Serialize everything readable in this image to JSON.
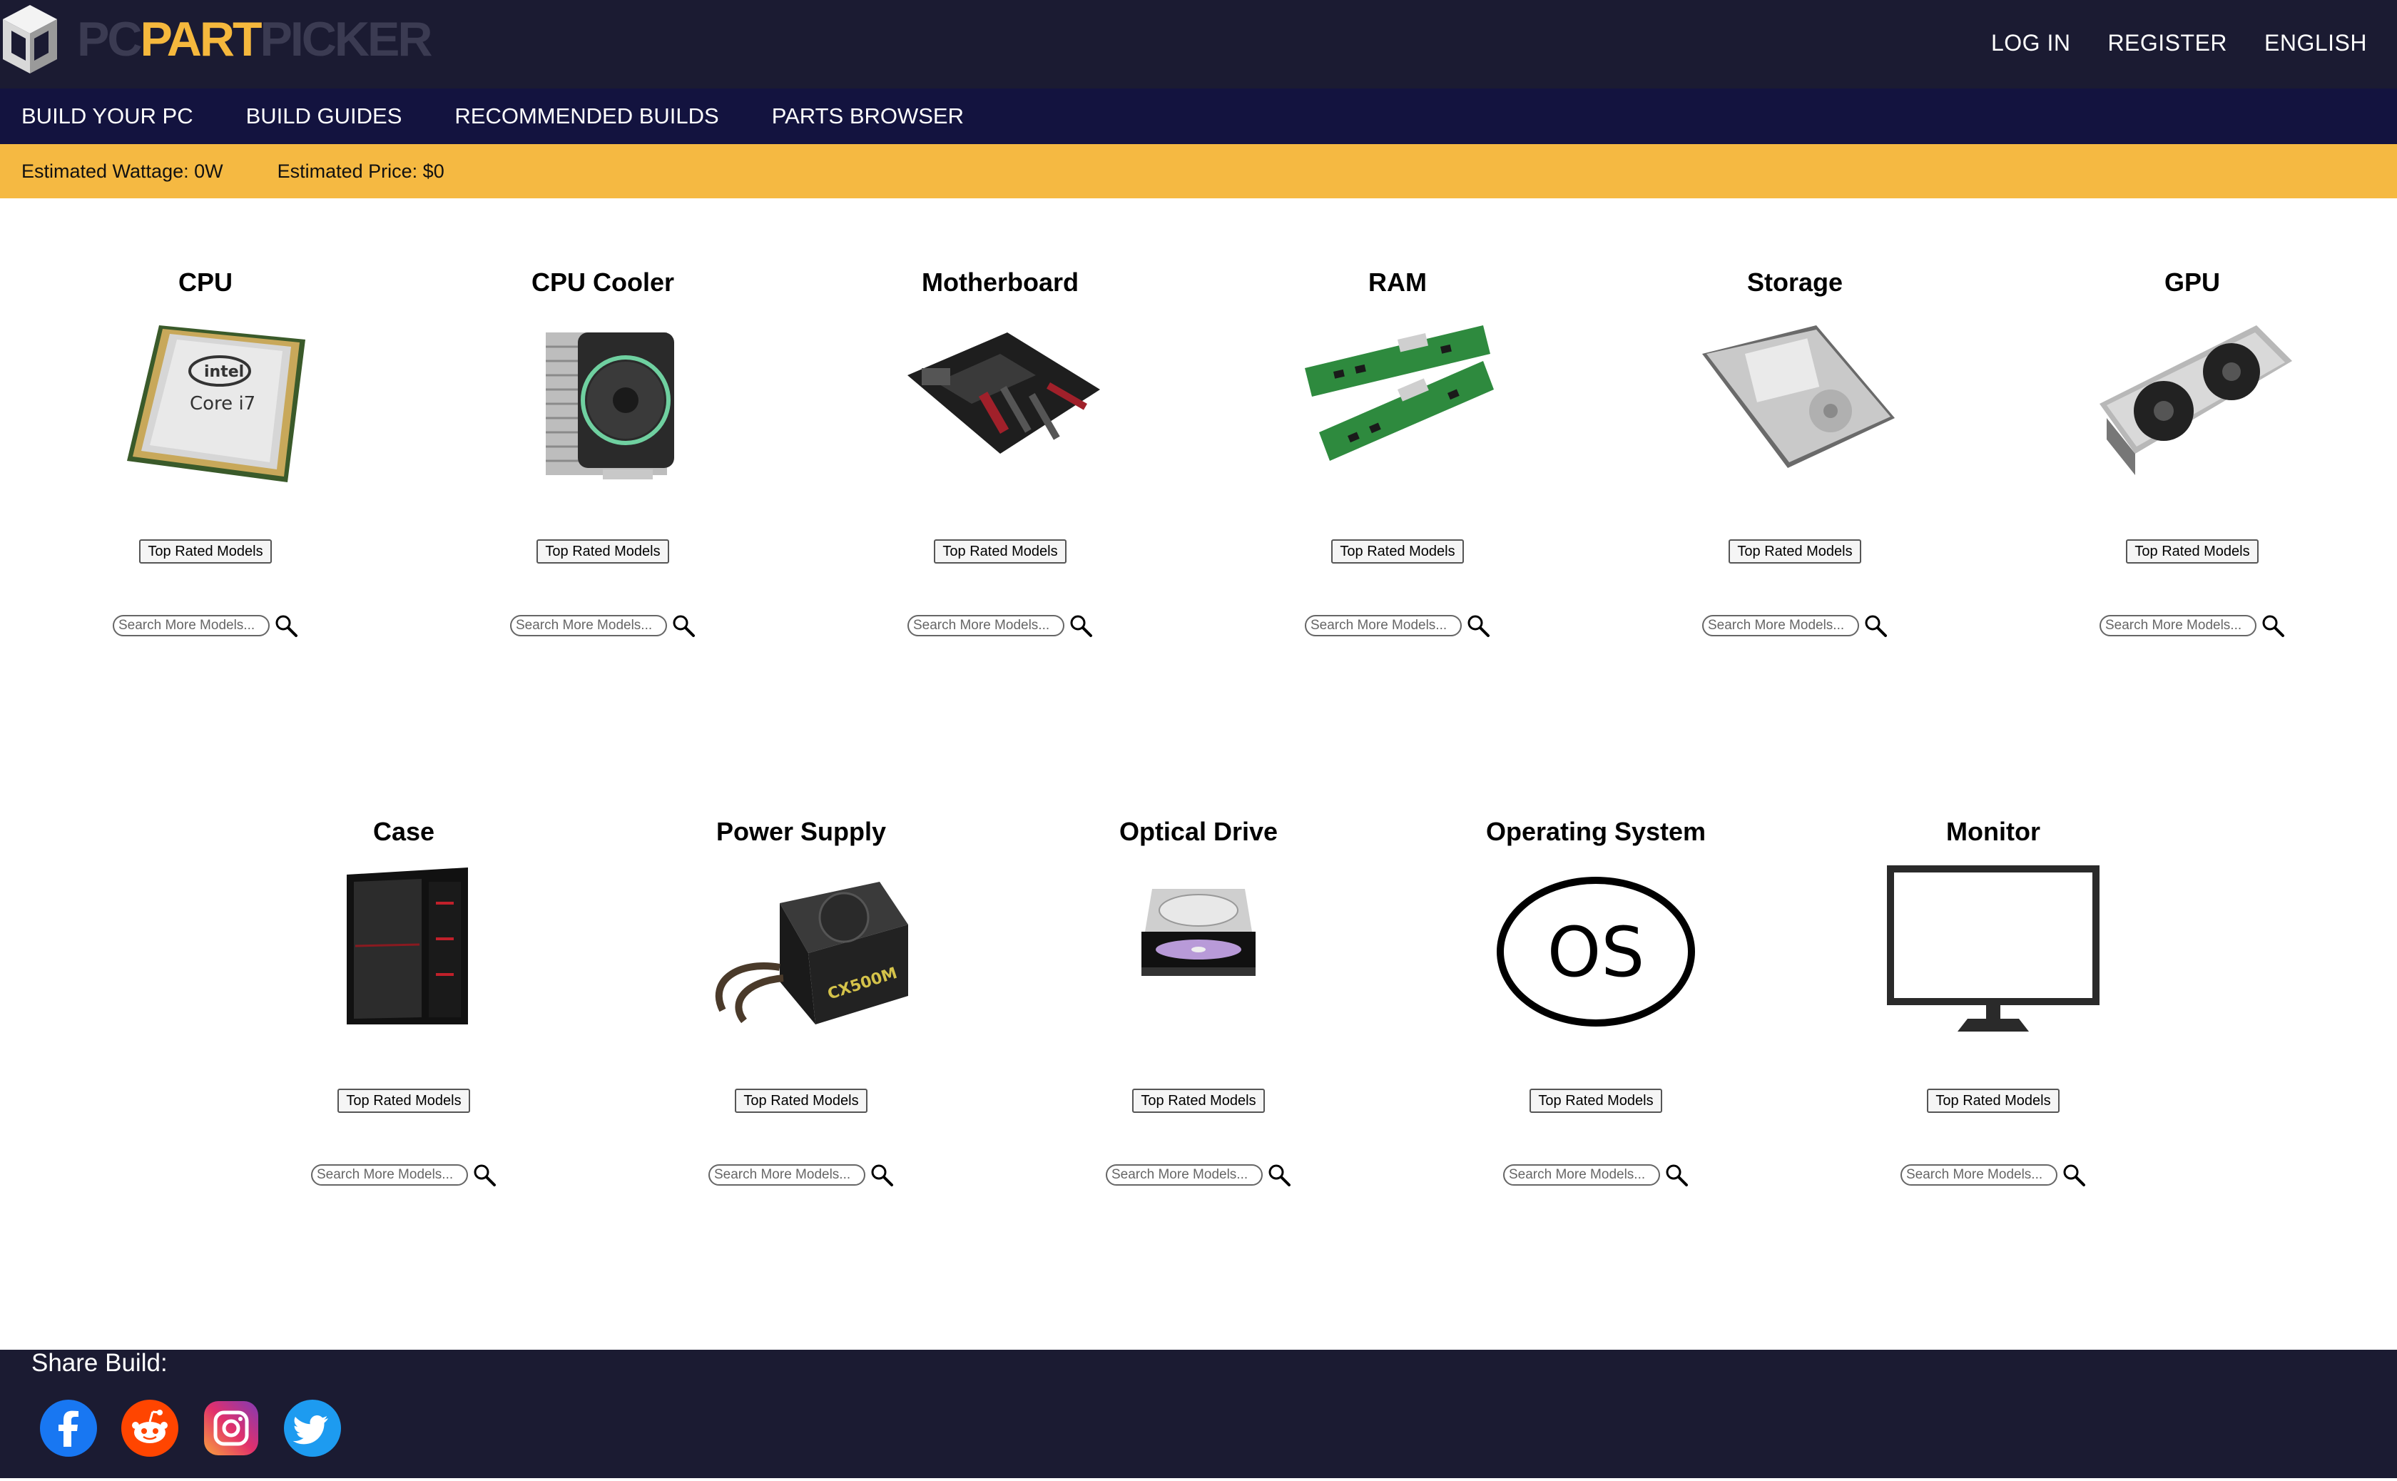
{
  "brand": {
    "pc": "PC",
    "part": "PART",
    "picker": "PICKER"
  },
  "top_links": {
    "login": "LOG IN",
    "register": "REGISTER",
    "language": "ENGLISH"
  },
  "nav": {
    "build": "BUILD YOUR PC",
    "guides": "BUILD GUIDES",
    "recommended": "RECOMMENDED BUILDS",
    "parts": "PARTS BROWSER"
  },
  "estimates": {
    "wattage": "Estimated Wattage: 0W",
    "price": "Estimated Price: $0"
  },
  "components": [
    {
      "name": "CPU",
      "button": "Top Rated Models",
      "placeholder": "Search More Models..."
    },
    {
      "name": "CPU Cooler",
      "button": "Top Rated Models",
      "placeholder": "Search More Models..."
    },
    {
      "name": "Motherboard",
      "button": "Top Rated Models",
      "placeholder": "Search More Models..."
    },
    {
      "name": "RAM",
      "button": "Top Rated Models",
      "placeholder": "Search More Models..."
    },
    {
      "name": "Storage",
      "button": "Top Rated Models",
      "placeholder": "Search More Models..."
    },
    {
      "name": "GPU",
      "button": "Top Rated Models",
      "placeholder": "Search More Models..."
    },
    {
      "name": "Case",
      "button": "Top Rated Models",
      "placeholder": "Search More Models..."
    },
    {
      "name": "Power Supply",
      "button": "Top Rated Models",
      "placeholder": "Search More Models..."
    },
    {
      "name": "Optical Drive",
      "button": "Top Rated Models",
      "placeholder": "Search More Models..."
    },
    {
      "name": "Operating System",
      "button": "Top Rated Models",
      "placeholder": "Search More Models..."
    },
    {
      "name": "Monitor",
      "button": "Top Rated Models",
      "placeholder": "Search More Models..."
    }
  ],
  "image_text": {
    "cpu_brand": "intel",
    "cpu_model": "Core i7",
    "psu_model": "CX500M",
    "os_label": "OS"
  },
  "footer": {
    "share_label": "Share Build:",
    "socials": [
      "facebook-icon",
      "reddit-icon",
      "instagram-icon",
      "twitter-icon"
    ]
  },
  "colors": {
    "header": "#1b1b32",
    "nav": "#13133f",
    "estimate_bar": "#f5b942",
    "brand_accent": "#f5b83d"
  }
}
